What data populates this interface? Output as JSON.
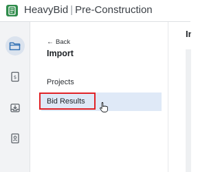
{
  "header": {
    "brand_name": "HeavyBid",
    "separator": "|",
    "product_name": "Pre-Construction",
    "logo_icon": "heavybid-logo-icon",
    "brand_color": "#2e8b4a"
  },
  "rail": {
    "items": [
      {
        "name": "folder-icon",
        "active": true
      },
      {
        "name": "estimate-document-icon",
        "active": false
      },
      {
        "name": "inbox-download-icon",
        "active": false
      },
      {
        "name": "contacts-book-icon",
        "active": false
      }
    ]
  },
  "panel": {
    "back_label": "Back",
    "title": "Import",
    "nav": {
      "projects_label": "Projects",
      "bid_results_label": "Bid Results"
    }
  },
  "content": {
    "title": "Im"
  },
  "colors": {
    "highlight_border": "#e02025",
    "selected_row": "#dfe9f7",
    "rail_bg": "#f2f3f5"
  }
}
